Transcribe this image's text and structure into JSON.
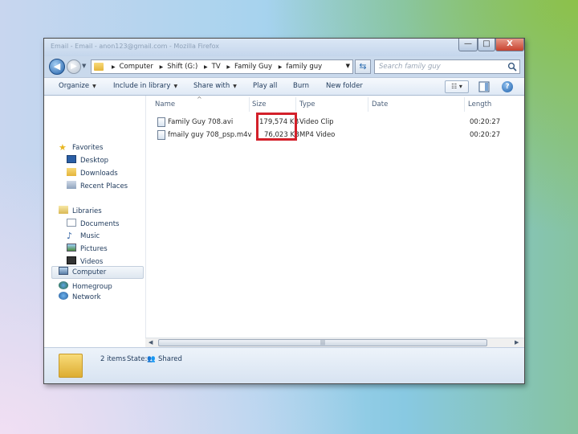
{
  "window": {
    "title": "Email - Email - anon123@gmail.com - Mozilla Firefox",
    "minimize_glyph": "—",
    "maximize_glyph": "□",
    "close_glyph": "X"
  },
  "address_bar": {
    "crumbs": [
      "Computer",
      "Shift (G:)",
      "TV",
      "Family Guy",
      "family guy"
    ],
    "search_placeholder": "Search family guy"
  },
  "toolbar": {
    "organize": "Organize",
    "include_in_library": "Include in library",
    "share_with": "Share with",
    "play_all": "Play all",
    "burn": "Burn",
    "new_folder": "New folder",
    "help": "?"
  },
  "nav": {
    "favorites": "Favorites",
    "desktop": "Desktop",
    "downloads": "Downloads",
    "recent_places": "Recent Places",
    "libraries": "Libraries",
    "documents": "Documents",
    "music": "Music",
    "pictures": "Pictures",
    "videos": "Videos",
    "homegroup": "Homegroup",
    "computer": "Computer",
    "network": "Network"
  },
  "columns": {
    "name": "Name",
    "size": "Size",
    "type": "Type",
    "date": "Date",
    "length": "Length"
  },
  "files": [
    {
      "name": "Family Guy 708.avi",
      "size": "179,574 KB",
      "type": "Video Clip",
      "length": "00:20:27"
    },
    {
      "name": "fmaily guy 708_psp.m4v",
      "size": "76,023 KB",
      "type": "MP4 Video",
      "length": "00:20:27"
    }
  ],
  "status": {
    "items": "2 items",
    "state_label": "State:",
    "state_value": "Shared"
  },
  "colors": {
    "highlight_box": "#d3202a",
    "accent": "#1e395b"
  }
}
